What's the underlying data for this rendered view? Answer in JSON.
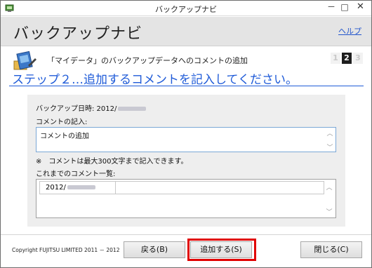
{
  "window": {
    "title": "バックアップナビ",
    "minimize": "－",
    "maximize": "□",
    "close": "✕"
  },
  "header": {
    "heading": "バックアップナビ",
    "help": "ヘルプ"
  },
  "task": {
    "title": "「マイデータ」のバックアップデータへのコメントの追加",
    "steps": [
      "1",
      "2",
      "3"
    ],
    "active_step": 2,
    "instruction": "ステップ２…追加するコメントを記入してください。"
  },
  "form": {
    "backup_date_label": "バックアップ日時: 2012/",
    "comment_label": "コメントの記入:",
    "comment_value": "コメントの追加",
    "note": "※　コメントは最大300文字まで記入できます。",
    "history_label": "これまでのコメント一覧:",
    "history_rows": [
      {
        "date": "2012/",
        "comment": ""
      }
    ]
  },
  "footer": {
    "copyright": "Copyright FUJITSU LIMITED 2011 － 2012",
    "back_button": "戻る(B)",
    "add_button": "追加する(S)",
    "close_button": "閉じる(C)"
  },
  "colors": {
    "accent_blue": "#1f5bd8",
    "highlight_red": "#e00000",
    "header_gray": "#e4e4e4",
    "panel_gray": "#eeeeee"
  }
}
